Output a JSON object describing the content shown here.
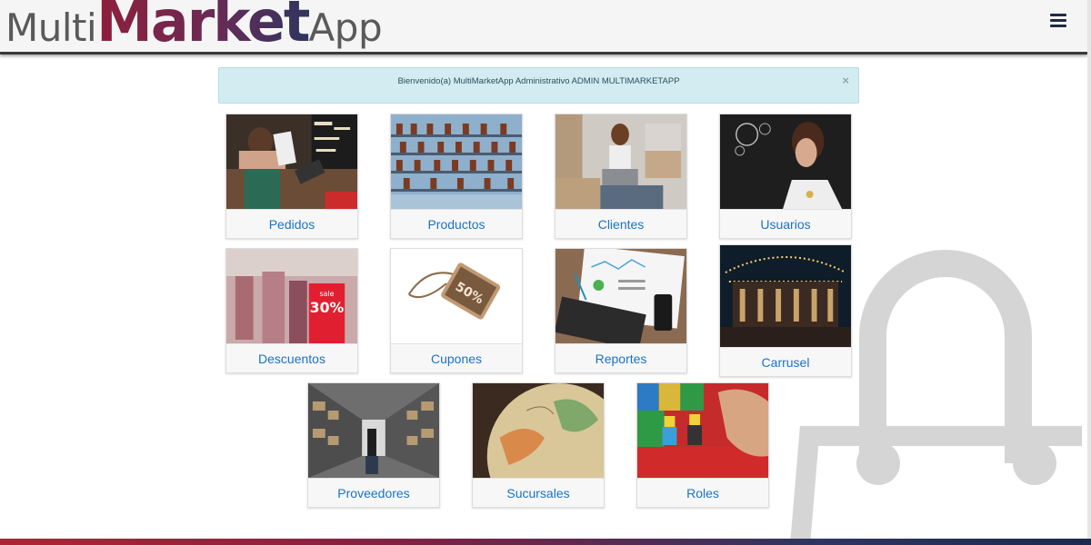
{
  "header": {
    "logo_multi": "Multi",
    "logo_market": "Market",
    "logo_app": "App",
    "menu_icon": "hamburger-menu-icon"
  },
  "alert": {
    "message": "Bienvenido(a) MultiMarketApp Administrativo ADMIN MULTIMARKETAPP",
    "close": "×"
  },
  "cards": [
    {
      "label": "Pedidos",
      "image": "waitress-tablet-image"
    },
    {
      "label": "Productos",
      "image": "shelves-jars-image"
    },
    {
      "label": "Clientes",
      "image": "woman-laptop-boxes-image"
    },
    {
      "label": "Usuarios",
      "image": "woman-hologram-image"
    },
    {
      "label": "Descuentos",
      "image": "sale-30-off-image"
    },
    {
      "label": "Cupones",
      "image": "special-offer-50-off-tag-image"
    },
    {
      "label": "Reportes",
      "image": "reports-keyboard-image"
    },
    {
      "label": "Carrusel",
      "image": "carousel-night-image"
    },
    {
      "label": "Proveedores",
      "image": "warehouse-aisle-image"
    },
    {
      "label": "Sucursales",
      "image": "globe-image"
    },
    {
      "label": "Roles",
      "image": "lego-figures-image"
    }
  ],
  "colors": {
    "link": "#1a73c8",
    "alert_bg": "#d3ecf1",
    "brand_red": "#8e1f3b",
    "brand_blue": "#2f3560"
  }
}
